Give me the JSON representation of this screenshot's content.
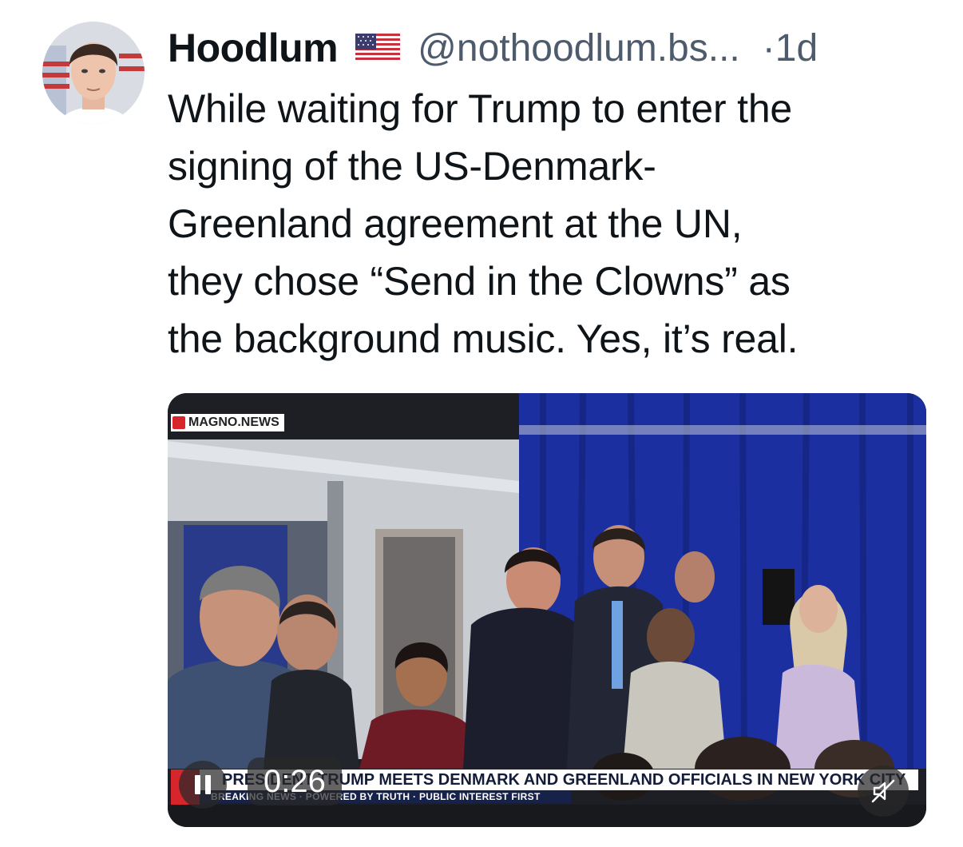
{
  "post": {
    "author_name": "Hoodlum",
    "author_flag": "us-flag-icon",
    "handle": "@nothoodlum.bs...",
    "separator": "·",
    "time_ago": "1d",
    "text_lines": [
      "While waiting for Trump to enter the",
      "signing of the US-Denmark-",
      "Greenland agreement at the UN,",
      "they chose “Send in the Clowns” as",
      "the background music. Yes, it’s real."
    ]
  },
  "video": {
    "watermark": "MAGNO.NEWS",
    "ticker_headline": "PRESIDENT TRUMP MEETS DENMARK AND GREENLAND OFFICIALS IN NEW YORK CITY",
    "ticker_sub": "BREAKING NEWS · POWERED BY TRUTH · PUBLIC INTEREST FIRST",
    "timecode": "0:26",
    "pause_icon": "pause-icon",
    "mute_icon": "muted-speaker-icon"
  },
  "colors": {
    "text": "#0f1419",
    "secondary": "#4e5b6d",
    "curtain": "#1b2fa0",
    "ticker_red": "#d7262b",
    "ticker_navy": "#16224a"
  }
}
